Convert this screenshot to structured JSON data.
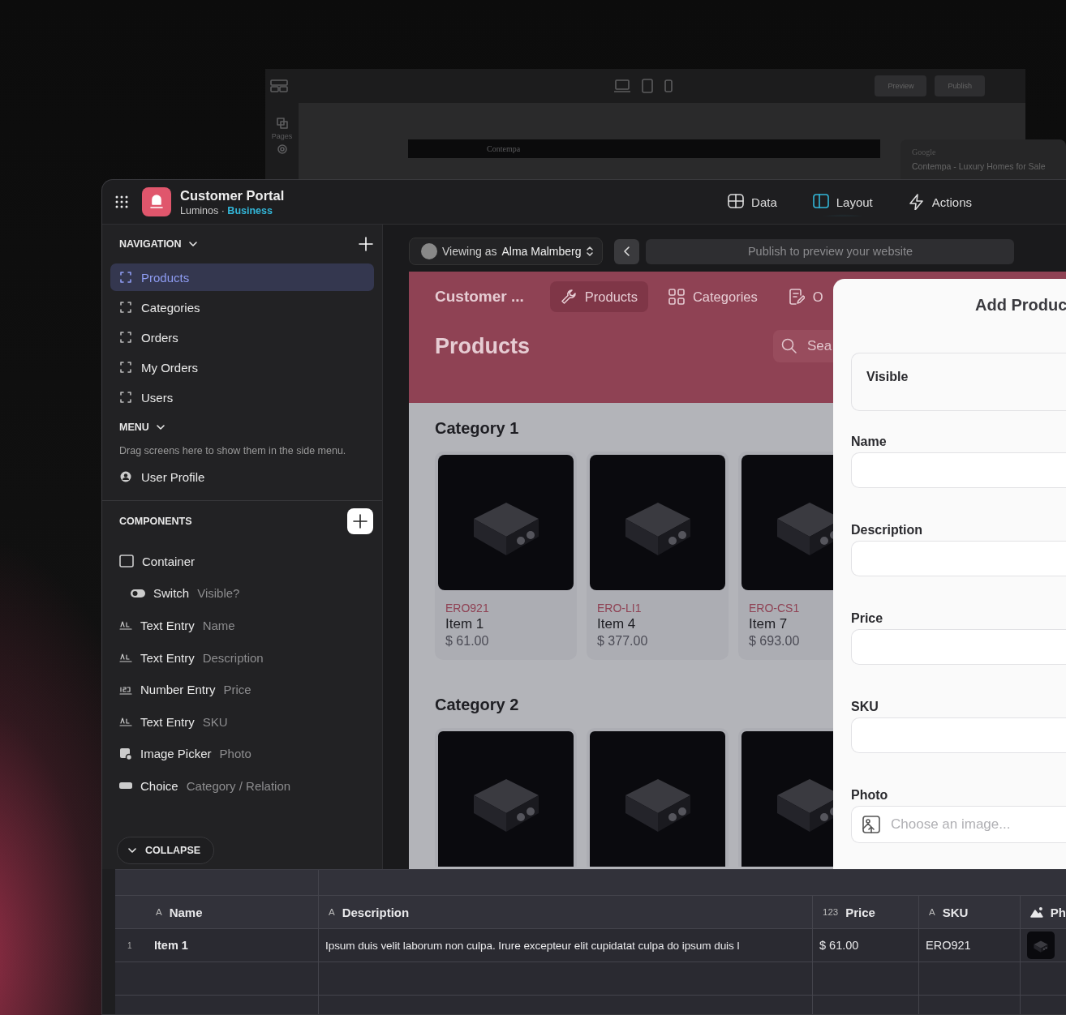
{
  "background_window": {
    "sidebar_label": "Pages",
    "buttons": [
      "Preview",
      "Publish"
    ],
    "site_title": "Contempa",
    "search_result": {
      "source": "Google",
      "title": "Contempa - Luxury Homes for Sale"
    }
  },
  "app": {
    "title": "Customer Portal",
    "org": "Luminos",
    "separator": "·",
    "plan": "Business"
  },
  "tabs": [
    {
      "label": "Data",
      "selected": false
    },
    {
      "label": "Layout",
      "selected": true
    },
    {
      "label": "Actions",
      "selected": false
    }
  ],
  "sidebar": {
    "navigation": {
      "title": "NAVIGATION",
      "items": [
        {
          "label": "Products",
          "selected": true
        },
        {
          "label": "Categories",
          "selected": false
        },
        {
          "label": "Orders",
          "selected": false
        },
        {
          "label": "My Orders",
          "selected": false
        },
        {
          "label": "Users",
          "selected": false
        }
      ]
    },
    "menu": {
      "title": "MENU",
      "hint": "Drag screens here to show them in the side menu.",
      "items": [
        {
          "label": "User Profile"
        }
      ]
    },
    "components": {
      "title": "COMPONENTS",
      "items": [
        {
          "kind": "container",
          "label": "Container",
          "children": [
            {
              "kind": "switch",
              "label": "Switch",
              "field": "Visible?"
            }
          ]
        },
        {
          "kind": "text",
          "label": "Text Entry",
          "field": "Name"
        },
        {
          "kind": "text",
          "label": "Text Entry",
          "field": "Description"
        },
        {
          "kind": "number",
          "label": "Number Entry",
          "field": "Price"
        },
        {
          "kind": "text",
          "label": "Text Entry",
          "field": "SKU"
        },
        {
          "kind": "image",
          "label": "Image Picker",
          "field": "Photo"
        },
        {
          "kind": "choice",
          "label": "Choice",
          "field": "Category / Relation"
        }
      ]
    },
    "collapse": "COLLAPSE"
  },
  "preview": {
    "viewing_label": "Viewing as",
    "viewer": "Alma Malmberg",
    "publish_hint": "Publish to preview your website",
    "app_title": "Customer ...",
    "tabs": [
      {
        "label": "Products",
        "selected": true
      },
      {
        "label": "Categories",
        "selected": false
      },
      {
        "label": "O",
        "selected": false
      }
    ],
    "page_title": "Products",
    "search_placeholder": "Sea",
    "categories": [
      {
        "title": "Category 1",
        "items": [
          {
            "kind": "product",
            "sku": "ERO921",
            "name": "Item 1",
            "price": "$ 61.00"
          },
          {
            "kind": "product",
            "sku": "ERO-LI1",
            "name": "Item 4",
            "price": "$ 377.00"
          },
          {
            "kind": "product",
            "sku": "ERO-CS1",
            "name": "Item 7",
            "price": "$ 693.00"
          }
        ]
      },
      {
        "title": "Category 2",
        "items": [
          {
            "kind": "photo"
          },
          {
            "kind": "photo"
          },
          {
            "kind": "photo"
          }
        ]
      }
    ]
  },
  "form": {
    "title": "Add Produc",
    "fields": [
      {
        "kind": "switch",
        "label": "Visible"
      },
      {
        "kind": "text",
        "label": "Name"
      },
      {
        "kind": "text",
        "label": "Description"
      },
      {
        "kind": "text",
        "label": "Price"
      },
      {
        "kind": "text",
        "label": "SKU"
      },
      {
        "kind": "image",
        "label": "Photo",
        "placeholder": "Choose an image..."
      }
    ]
  },
  "table": {
    "columns": [
      {
        "type_label": "A",
        "label": "Name"
      },
      {
        "type_label": "A",
        "label": "Description"
      },
      {
        "type_label": "123",
        "label": "Price"
      },
      {
        "type_label": "A",
        "label": "SKU"
      },
      {
        "label": "Ph",
        "kind": "image"
      }
    ],
    "rows": [
      {
        "number": "1",
        "cells": [
          "Item 1",
          "Ipsum duis velit laborum non culpa. Irure excepteur elit cupidatat culpa do ipsum duis l",
          "$ 61.00",
          "ERO921"
        ]
      }
    ]
  }
}
